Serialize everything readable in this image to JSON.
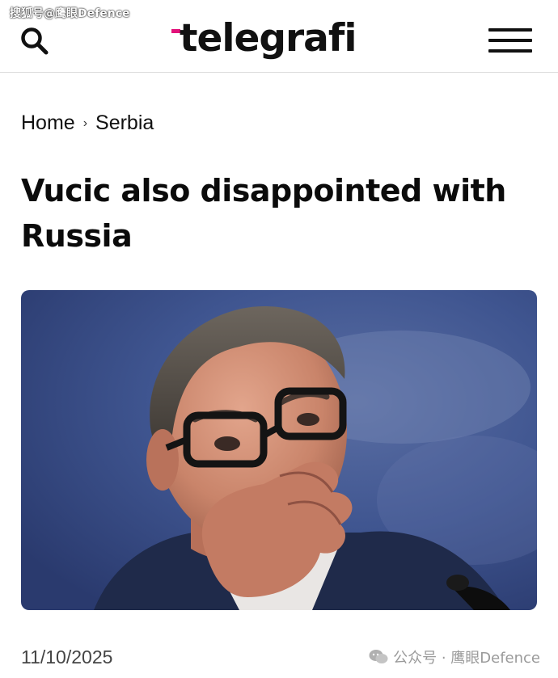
{
  "watermark_top": "搜狐号@鹰眼Defence",
  "header": {
    "logo_text": "telegrafi",
    "brand_color": "#e2127a",
    "search_icon": "search-icon",
    "menu_icon": "hamburger-menu-icon"
  },
  "breadcrumb": {
    "home": "Home",
    "separator": "›",
    "section": "Serbia"
  },
  "article": {
    "headline": "Vucic also disappointed with Russia",
    "hero_image_alt": "Vucic",
    "date": "11/10/2025"
  },
  "watermark_bottom": "公众号 · 鹰眼Defence"
}
